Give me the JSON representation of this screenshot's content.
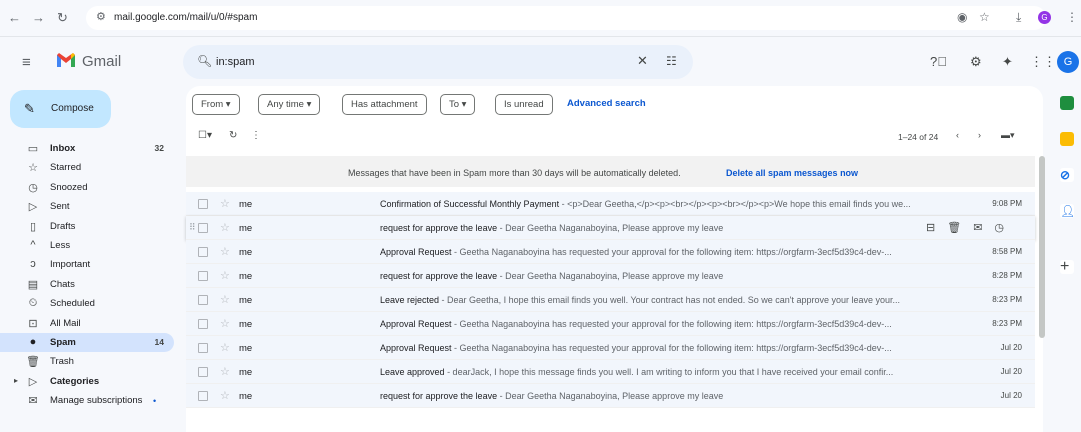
{
  "browser": {
    "url": "mail.google.com/mail/u/0/#spam",
    "profile_initial": "G"
  },
  "header": {
    "brand": "Gmail",
    "search_query": "in:spam",
    "avatar_initial": "G"
  },
  "sidebar": {
    "compose_label": "Compose",
    "items": [
      {
        "label": "Inbox",
        "count": "32",
        "icon": "inbox-icon",
        "bold": true
      },
      {
        "label": "Starred",
        "count": "",
        "icon": "star-icon"
      },
      {
        "label": "Snoozed",
        "count": "",
        "icon": "clock-icon"
      },
      {
        "label": "Sent",
        "count": "",
        "icon": "send-icon"
      },
      {
        "label": "Drafts",
        "count": "",
        "icon": "draft-icon"
      },
      {
        "label": "Less",
        "count": "",
        "icon": "chevron-up-icon"
      },
      {
        "label": "Important",
        "count": "",
        "icon": "important-icon"
      },
      {
        "label": "Chats",
        "count": "",
        "icon": "chat-icon"
      },
      {
        "label": "Scheduled",
        "count": "",
        "icon": "scheduled-icon"
      },
      {
        "label": "All Mail",
        "count": "",
        "icon": "all-mail-icon"
      },
      {
        "label": "Spam",
        "count": "14",
        "icon": "spam-icon",
        "bold": true,
        "active": true
      },
      {
        "label": "Trash",
        "count": "",
        "icon": "trash-icon"
      },
      {
        "label": "Categories",
        "count": "",
        "icon": "label-icon",
        "bold": true
      },
      {
        "label": "Manage subscriptions",
        "count": "",
        "icon": "subscriptions-icon"
      }
    ]
  },
  "filters": {
    "from": "From",
    "any_time": "Any time",
    "has_attachment": "Has attachment",
    "to": "To",
    "is_unread": "Is unread",
    "advanced_search": "Advanced search"
  },
  "toolbar": {
    "pager": "1–24 of 24"
  },
  "banner": {
    "message": "Messages that have been in Spam more than 30 days will be automatically deleted.",
    "action": "Delete all spam messages now"
  },
  "emails": [
    {
      "sender": "me",
      "subject": "Confirmation of Successful Monthly Payment",
      "snippet": " - <p>Dear Geetha,</p><p><br></p><p><br></p><p>We hope this email finds you we...",
      "date": "9:08 PM"
    },
    {
      "sender": "me",
      "subject": "request for approve the leave",
      "snippet": " - Dear Geetha Naganaboyina, Please approve my leave",
      "date": "",
      "hover": true
    },
    {
      "sender": "me",
      "subject": "Approval Request",
      "snippet": " - Geetha Naganaboyina has requested your approval for the following item: https://orgfarm-3ecf5d39c4-dev-...",
      "date": "8:58 PM"
    },
    {
      "sender": "me",
      "subject": "request for approve the leave",
      "snippet": " - Dear Geetha Naganaboyina, Please approve my leave",
      "date": "8:28 PM"
    },
    {
      "sender": "me",
      "subject": "Leave rejected",
      "snippet": " - Dear Geetha, I hope this email finds you well. Your contract has not ended. So we can't approve your leave your...",
      "date": "8:23 PM"
    },
    {
      "sender": "me",
      "subject": "Approval Request",
      "snippet": " - Geetha Naganaboyina has requested your approval for the following item: https://orgfarm-3ecf5d39c4-dev-...",
      "date": "8:23 PM"
    },
    {
      "sender": "me",
      "subject": "Approval Request",
      "snippet": " - Geetha Naganaboyina has requested your approval for the following item: https://orgfarm-3ecf5d39c4-dev-...",
      "date": "Jul 20"
    },
    {
      "sender": "me",
      "subject": "Leave approved",
      "snippet": " - dearJack, I hope this message finds you well. I am writing to inform you that I have received your email confir...",
      "date": "Jul 20"
    },
    {
      "sender": "me",
      "subject": "request for approve the leave",
      "snippet": " - Dear Geetha Naganaboyina, Please approve my leave",
      "date": "Jul 20"
    }
  ],
  "colors": {
    "accent": "#0b57d0",
    "compose_bg": "#c2e7ff",
    "active_nav_bg": "#d3e3fd",
    "search_bg": "#eaf1fb"
  }
}
